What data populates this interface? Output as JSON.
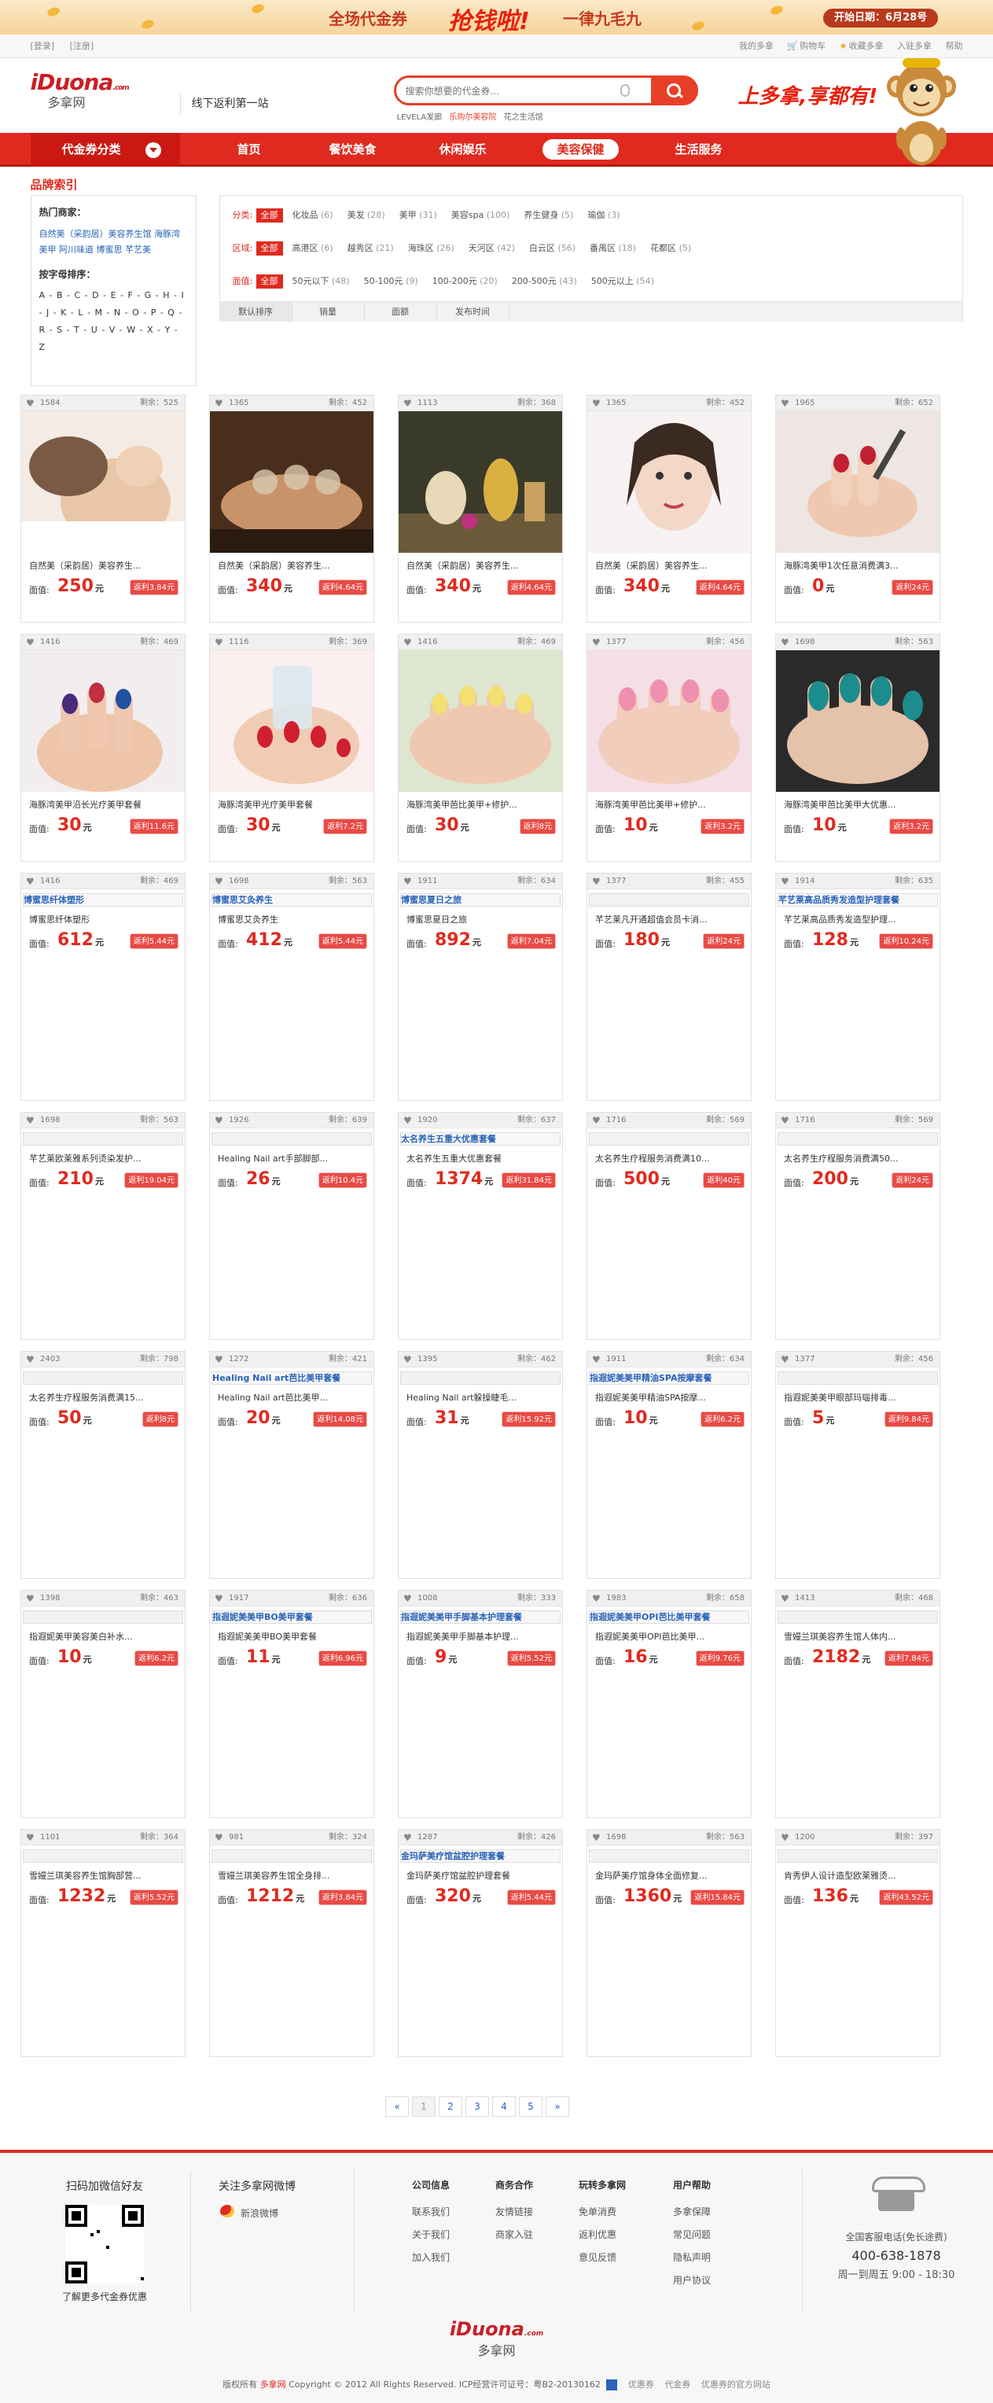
{
  "banner": {
    "text1": "全场代金券",
    "text2": "抢钱啦!",
    "text3": "一律九毛九",
    "date": "开始日期：6月28号"
  },
  "topbar": {
    "left": [
      "[登录]",
      "[注册]"
    ],
    "right": [
      "我的多拿",
      "购物车",
      "收藏多拿",
      "入驻多拿",
      "帮助"
    ]
  },
  "header": {
    "logo": "iDuona",
    "logo_domain": ".com",
    "logo_cn": "多拿网",
    "slogan": "线下返利第一站",
    "search_placeholder": "搜索你想要的代金券...",
    "hotwords": [
      "LEVELA发廊",
      "乐购尔美容院",
      "花之生活馆"
    ],
    "tagline": "上多拿,享都有!"
  },
  "nav": {
    "category": "代金券分类",
    "items": [
      {
        "label": "首页",
        "active": false
      },
      {
        "label": "餐饮美食",
        "active": false
      },
      {
        "label": "休闲娱乐",
        "active": false
      },
      {
        "label": "美容保健",
        "active": true
      },
      {
        "label": "生活服务",
        "active": false
      }
    ]
  },
  "brand": {
    "title": "品牌索引",
    "hot_title": "热门商家：",
    "hot_links": "自然美（采韵居）美容养生馆  海豚湾美甲  阿川味道  博蜜思  芊艺美",
    "az_title": "按字母排序：",
    "letters": "A - B - C - D - E - F - G - H - I - J - K - L - M - N - O - P - Q - R - S - T - U - V - W - X - Y - Z"
  },
  "filters": [
    {
      "label": "分类:",
      "all": "全部",
      "options": [
        [
          "化妆品",
          "(6)"
        ],
        [
          "美发",
          "(28)"
        ],
        [
          "美甲",
          "(31)"
        ],
        [
          "美容spa",
          "(100)"
        ],
        [
          "养生健身",
          "(5)"
        ],
        [
          "瑜伽",
          "(3)"
        ]
      ]
    },
    {
      "label": "区域:",
      "all": "全部",
      "options": [
        [
          "高港区",
          "(6)"
        ],
        [
          "越秀区",
          "(21)"
        ],
        [
          "海珠区",
          "(26)"
        ],
        [
          "天河区",
          "(42)"
        ],
        [
          "白云区",
          "(56)"
        ],
        [
          "番禺区",
          "(18)"
        ],
        [
          "花都区",
          "(5)"
        ]
      ]
    },
    {
      "label": "面值:",
      "all": "全部",
      "options": [
        [
          "50元以下",
          "(48)"
        ],
        [
          "50-100元",
          "(9)"
        ],
        [
          "100-200元",
          "(20)"
        ],
        [
          "200-500元",
          "(43)"
        ],
        [
          "500元以上",
          "(54)"
        ]
      ]
    }
  ],
  "sort": [
    "默认排序",
    "销量",
    "面额",
    "发布时间"
  ],
  "products": [
    {
      "likes": "1584",
      "remain": "剩余：525",
      "name": "自然美（采韵居）美容养生...",
      "price": "250",
      "rebate": "返利3.84元",
      "img": "face"
    },
    {
      "likes": "1365",
      "remain": "剩余：452",
      "name": "自然美（采韵居）美容养生...",
      "price": "340",
      "rebate": "返利4.64元",
      "img": "spa"
    },
    {
      "likes": "1113",
      "remain": "剩余：368",
      "name": "自然美（采韵居）美容养生...",
      "price": "340",
      "rebate": "返利4.64元",
      "img": "oil"
    },
    {
      "likes": "1365",
      "remain": "剩余：452",
      "name": "自然美（采韵居）美容养生...",
      "price": "340",
      "rebate": "返利4.64元",
      "img": "beauty"
    },
    {
      "likes": "1965",
      "remain": "剩余：652",
      "name": "海豚湾美甲1次任意消费满3...",
      "price": "0",
      "rebate": "返利24元",
      "img": "nails1"
    },
    {
      "likes": "1416",
      "remain": "剩余：469",
      "name": "海豚湾美甲沿长光疗美甲套餐",
      "price": "30",
      "rebate": "返利11.6元",
      "img": "nails2"
    },
    {
      "likes": "1116",
      "remain": "剩余：369",
      "name": "海豚湾美甲光疗美甲套餐",
      "price": "30",
      "rebate": "返利7.2元",
      "img": "nails3"
    },
    {
      "likes": "1416",
      "remain": "剩余：469",
      "name": "海豚湾美甲芭比美甲+修护...",
      "price": "30",
      "rebate": "返利8元",
      "img": "nails4"
    },
    {
      "likes": "1377",
      "remain": "剩余：456",
      "name": "海豚湾美甲芭比美甲+修护...",
      "price": "10",
      "rebate": "返利3.2元",
      "img": "nails5"
    },
    {
      "likes": "1698",
      "remain": "剩余：563",
      "name": "海豚湾美甲芭比美甲大优惠...",
      "price": "10",
      "rebate": "返利3.2元",
      "img": "nails6"
    },
    {
      "likes": "1416",
      "remain": "剩余：469",
      "title": "博蜜思纤体塑形",
      "name": "博蜜思纤体塑形",
      "price": "612",
      "rebate": "返利5.44元"
    },
    {
      "likes": "1698",
      "remain": "剩余：563",
      "title": "博蜜思艾灸养生",
      "name": "博蜜思艾灸养生",
      "price": "412",
      "rebate": "返利5.44元"
    },
    {
      "likes": "1911",
      "remain": "剩余：634",
      "title": "博蜜思夏日之旅",
      "name": "博蜜思夏日之旅",
      "price": "892",
      "rebate": "返利7.04元"
    },
    {
      "likes": "1377",
      "remain": "剩余：455",
      "title": "",
      "name": "芊艺莱凡开通超值会员卡消...",
      "price": "180",
      "rebate": "返利24元"
    },
    {
      "likes": "1914",
      "remain": "剩余：635",
      "title": "芊艺莱高品质秀发造型护理套餐",
      "name": "芊艺莱高品质秀发造型护理...",
      "price": "128",
      "rebate": "返利10.24元"
    },
    {
      "likes": "1698",
      "remain": "剩余：563",
      "title": "",
      "name": "芊艺莱欧莱雅系列烫染发护...",
      "price": "210",
      "rebate": "返利19.04元"
    },
    {
      "likes": "1926",
      "remain": "剩余：639",
      "title": "",
      "name": "Healing Nail art手部脚部...",
      "price": "26",
      "rebate": "返利10.4元"
    },
    {
      "likes": "1920",
      "remain": "剩余：637",
      "title": "太名养生五重大优惠套餐",
      "name": "太名养生五重大优惠套餐",
      "price": "1374",
      "rebate": "返利31.84元"
    },
    {
      "likes": "1716",
      "remain": "剩余：569",
      "title": "",
      "name": "太名养生疗程服务消费满10...",
      "price": "500",
      "rebate": "返利40元"
    },
    {
      "likes": "1716",
      "remain": "剩余：569",
      "title": "",
      "name": "太名养生疗程服务消费满50...",
      "price": "200",
      "rebate": "返利24元"
    },
    {
      "likes": "2403",
      "remain": "剩余：798",
      "title": "",
      "name": "太名养生疗程服务消费满15...",
      "price": "50",
      "rebate": "返利8元"
    },
    {
      "likes": "1272",
      "remain": "剩余：421",
      "title": "Healing Nail art芭比美甲套餐",
      "name": "Healing Nail art芭比美甲...",
      "price": "20",
      "rebate": "返利14.08元"
    },
    {
      "likes": "1395",
      "remain": "剩余：462",
      "title": "",
      "name": "Healing Nail art躲操睫毛...",
      "price": "31",
      "rebate": "返利15.92元"
    },
    {
      "likes": "1911",
      "remain": "剩余：634",
      "title": "指遐妮美美甲精油SPA按摩套餐",
      "name": "指遐妮美美甲精油SPA按摩...",
      "price": "10",
      "rebate": "返利6.2元"
    },
    {
      "likes": "1377",
      "remain": "剩余：456",
      "title": "",
      "name": "指遐妮美美甲眼部玛瑙排毒...",
      "price": "5",
      "rebate": "返利9.84元"
    },
    {
      "likes": "1398",
      "remain": "剩余：463",
      "title": "",
      "name": "指遐妮美甲美容美白补水...",
      "price": "10",
      "rebate": "返利6.2元"
    },
    {
      "likes": "1917",
      "remain": "剩余：636",
      "title": "指遐妮美美甲BO美甲套餐",
      "name": "指遐妮美美甲BO美甲套餐",
      "price": "11",
      "rebate": "返利6.96元"
    },
    {
      "likes": "1008",
      "remain": "剩余：333",
      "title": "指遐妮美美甲手脚基本护理套餐",
      "name": "指遐妮美美甲手脚基本护理...",
      "price": "9",
      "rebate": "返利5.52元"
    },
    {
      "likes": "1983",
      "remain": "剩余：658",
      "title": "指遐妮美美甲OPI芭比美甲套餐",
      "name": "指遐妮美美甲OPI芭比美甲...",
      "price": "16",
      "rebate": "返利9.76元"
    },
    {
      "likes": "1413",
      "remain": "剩余：468",
      "title": "",
      "name": "雪嫚兰琪美容养生馆人体内...",
      "price": "2182",
      "rebate": "返利7.84元"
    },
    {
      "likes": "1101",
      "remain": "剩余：364",
      "title": "",
      "name": "雪嫚兰琪美容养生馆胸部营...",
      "price": "1232",
      "rebate": "返利5.52元"
    },
    {
      "likes": "981",
      "remain": "剩余：324",
      "title": "",
      "name": "雪嫚兰琪美容养生馆全身排...",
      "price": "1212",
      "rebate": "返利3.84元"
    },
    {
      "likes": "1287",
      "remain": "剩余：426",
      "title": "金玛萨美疗馆盆腔护理套餐",
      "name": "金玛萨美疗馆盆腔护理套餐",
      "price": "320",
      "rebate": "返利5.44元"
    },
    {
      "likes": "1698",
      "remain": "剩余：563",
      "title": "",
      "name": "金玛萨美疗馆身体全面修复...",
      "price": "1360",
      "rebate": "返利15.84元"
    },
    {
      "likes": "1200",
      "remain": "剩余：397",
      "title": "",
      "name": "肯秀伊人设计造型欧莱雅烫...",
      "price": "136",
      "rebate": "返利43.52元"
    }
  ],
  "card_labels": {
    "face": "面值:",
    "unit": "元"
  },
  "pager": [
    "«",
    "1",
    "2",
    "3",
    "4",
    "5",
    "»"
  ],
  "footer": {
    "wechat_title": "扫码加微信好友",
    "wechat_desc": "了解更多代金券优惠",
    "weibo_title": "关注多拿网微博",
    "weibo_link": "新浪微博",
    "cols": [
      {
        "title": "公司信息",
        "items": [
          "联系我们",
          "关于我们",
          "加入我们"
        ]
      },
      {
        "title": "商务合作",
        "items": [
          "友情链接",
          "商家入驻"
        ]
      },
      {
        "title": "玩转多拿网",
        "items": [
          "免单消费",
          "返利优惠",
          "意见反馈"
        ]
      },
      {
        "title": "用户帮助",
        "items": [
          "多拿保障",
          "常见问题",
          "隐私声明",
          "用户协议"
        ]
      }
    ],
    "hotline_label": "全国客服电话(免长途费)",
    "hotline": "400-638-1878",
    "hours": "周一到周五 9:00 - 18:30",
    "logo": "iDuona",
    "logo_domain": ".com",
    "logo_cn": "多拿网",
    "copy_prefix": "版权所有",
    "copy_brand": "多拿网",
    "copy_text": "Copyright © 2012 All Rights Reserved. ICP经营许可证号：粤B2-20130162",
    "copy_links": [
      "优惠券",
      "代金券",
      "优惠券的官方网站"
    ]
  }
}
